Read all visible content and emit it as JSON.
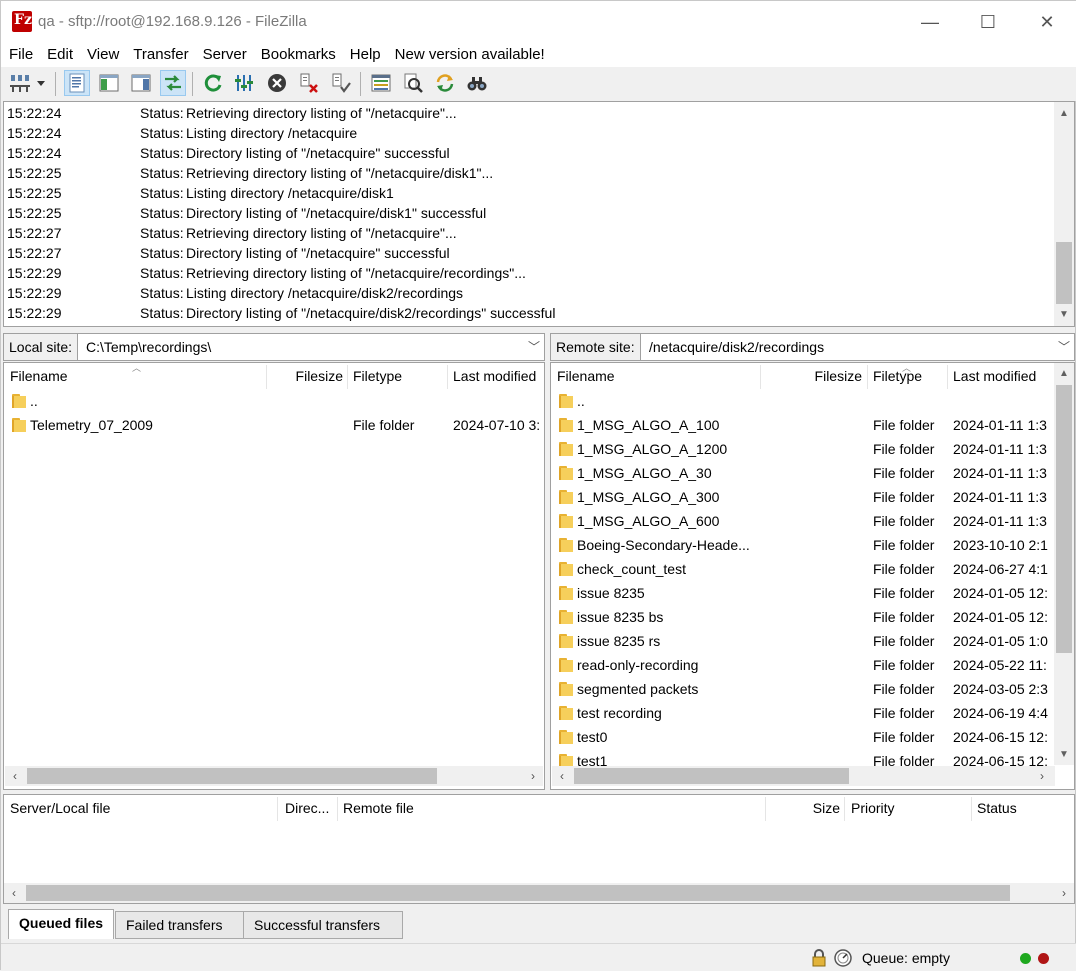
{
  "window": {
    "title": "qa - sftp://root@192.168.9.126 - FileZilla",
    "app_icon_letter": "Fz",
    "minimize": "—",
    "maximize": "☐",
    "close": "✕"
  },
  "menu": [
    "File",
    "Edit",
    "View",
    "Transfer",
    "Server",
    "Bookmarks",
    "Help",
    "New version available!"
  ],
  "toolbar": {
    "icons": [
      "site-manager-icon",
      "dropdown-arrow-icon",
      "toggle-message-log-icon",
      "toggle-local-tree-icon",
      "toggle-remote-tree-icon",
      "toggle-transfer-queue-icon",
      "refresh-icon",
      "process-queue-icon",
      "cancel-icon",
      "disconnect-icon",
      "reconnect-icon",
      "directory-comparison-icon",
      "filter-icon",
      "sync-browsing-icon",
      "search-icon"
    ]
  },
  "log": [
    {
      "time": "15:22:24",
      "status": "Status:",
      "msg": "Retrieving directory listing of \"/netacquire\"..."
    },
    {
      "time": "15:22:24",
      "status": "Status:",
      "msg": "Listing directory /netacquire"
    },
    {
      "time": "15:22:24",
      "status": "Status:",
      "msg": "Directory listing of \"/netacquire\" successful"
    },
    {
      "time": "15:22:25",
      "status": "Status:",
      "msg": "Retrieving directory listing of \"/netacquire/disk1\"..."
    },
    {
      "time": "15:22:25",
      "status": "Status:",
      "msg": "Listing directory /netacquire/disk1"
    },
    {
      "time": "15:22:25",
      "status": "Status:",
      "msg": "Directory listing of \"/netacquire/disk1\" successful"
    },
    {
      "time": "15:22:27",
      "status": "Status:",
      "msg": "Retrieving directory listing of \"/netacquire\"..."
    },
    {
      "time": "15:22:27",
      "status": "Status:",
      "msg": "Directory listing of \"/netacquire\" successful"
    },
    {
      "time": "15:22:29",
      "status": "Status:",
      "msg": "Retrieving directory listing of \"/netacquire/recordings\"..."
    },
    {
      "time": "15:22:29",
      "status": "Status:",
      "msg": "Listing directory /netacquire/disk2/recordings"
    },
    {
      "time": "15:22:29",
      "status": "Status:",
      "msg": "Directory listing of \"/netacquire/disk2/recordings\" successful"
    }
  ],
  "local": {
    "label": "Local site:",
    "path": "C:\\Temp\\recordings\\",
    "columns": [
      "Filename",
      "Filesize",
      "Filetype",
      "Last modified"
    ],
    "files": [
      {
        "name": "..",
        "size": "",
        "type": "",
        "modified": ""
      },
      {
        "name": "Telemetry_07_2009",
        "size": "",
        "type": "File folder",
        "modified": "2024-07-10 3:"
      }
    ]
  },
  "remote": {
    "label": "Remote site:",
    "path": "/netacquire/disk2/recordings",
    "columns": [
      "Filename",
      "Filesize",
      "Filetype",
      "Last modified"
    ],
    "files": [
      {
        "name": "..",
        "size": "",
        "type": "",
        "modified": ""
      },
      {
        "name": "1_MSG_ALGO_A_100",
        "size": "",
        "type": "File folder",
        "modified": "2024-01-11 1:3"
      },
      {
        "name": "1_MSG_ALGO_A_1200",
        "size": "",
        "type": "File folder",
        "modified": "2024-01-11 1:3"
      },
      {
        "name": "1_MSG_ALGO_A_30",
        "size": "",
        "type": "File folder",
        "modified": "2024-01-11 1:3"
      },
      {
        "name": "1_MSG_ALGO_A_300",
        "size": "",
        "type": "File folder",
        "modified": "2024-01-11 1:3"
      },
      {
        "name": "1_MSG_ALGO_A_600",
        "size": "",
        "type": "File folder",
        "modified": "2024-01-11 1:3"
      },
      {
        "name": "Boeing-Secondary-Heade...",
        "size": "",
        "type": "File folder",
        "modified": "2023-10-10 2:1"
      },
      {
        "name": "check_count_test",
        "size": "",
        "type": "File folder",
        "modified": "2024-06-27 4:1"
      },
      {
        "name": "issue 8235",
        "size": "",
        "type": "File folder",
        "modified": "2024-01-05 12:"
      },
      {
        "name": "issue 8235 bs",
        "size": "",
        "type": "File folder",
        "modified": "2024-01-05 12:"
      },
      {
        "name": "issue 8235 rs",
        "size": "",
        "type": "File folder",
        "modified": "2024-01-05 1:0"
      },
      {
        "name": "read-only-recording",
        "size": "",
        "type": "File folder",
        "modified": "2024-05-22 11:"
      },
      {
        "name": "segmented packets",
        "size": "",
        "type": "File folder",
        "modified": "2024-03-05 2:3"
      },
      {
        "name": "test recording",
        "size": "",
        "type": "File folder",
        "modified": "2024-06-19 4:4"
      },
      {
        "name": "test0",
        "size": "",
        "type": "File folder",
        "modified": "2024-06-15 12:"
      },
      {
        "name": "test1",
        "size": "",
        "type": "File folder",
        "modified": "2024-06-15 12:"
      }
    ]
  },
  "queue": {
    "columns": [
      "Server/Local file",
      "Direc...",
      "Remote file",
      "Size",
      "Priority",
      "Status"
    ]
  },
  "tabs": [
    "Queued files",
    "Failed transfers",
    "Successful transfers"
  ],
  "statusbar": {
    "queue_text": "Queue: empty",
    "icons": [
      "lock-icon",
      "speed-limit-icon"
    ],
    "led_colors": [
      "#1fa81f",
      "#b01515"
    ]
  }
}
